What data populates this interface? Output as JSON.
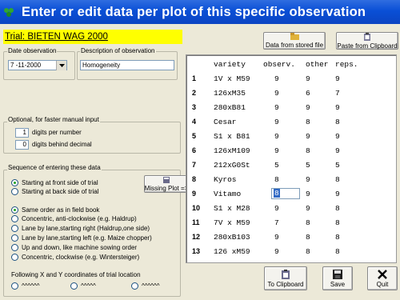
{
  "window": {
    "title": "Enter or edit data per plot of this specific observation",
    "icon": "app-icon"
  },
  "trial": {
    "label": "Trial:  BIETEN WAG 2000"
  },
  "date_observation": {
    "label": "Date observation",
    "value": "7 -11-2000"
  },
  "description": {
    "label": "Description of observation",
    "value": "Homogeneity"
  },
  "optional": {
    "label": "Optional, for faster manual input",
    "digits_per_number_value": "1",
    "digits_per_number_label": "digits per number",
    "digits_decimal_value": "0",
    "digits_decimal_label": "digits behind decimal"
  },
  "sequence": {
    "label": "Sequence of entering these data",
    "side_options": [
      {
        "label": "Starting at front side of trial",
        "checked": true
      },
      {
        "label": "Starting at back side of trial",
        "checked": false
      }
    ],
    "order_options": [
      {
        "label": "Same order as in field book",
        "checked": true
      },
      {
        "label": "Concentric, anti-clockwise (e.g. Haldrup)",
        "checked": false
      },
      {
        "label": "Lane by lane,starting right (Haldrup,one side)",
        "checked": false
      },
      {
        "label": "Lane by lane,starting left (e.g. Maize chopper)",
        "checked": false
      },
      {
        "label": "Up and down, like machine sowing order",
        "checked": false
      },
      {
        "label": "Concentric, clockwise (e.g. Wintersteiger)",
        "checked": false
      }
    ],
    "coords_label": "Following X and Y coordinates of trial location",
    "coord_options": [
      {
        "label": "^^^^^^",
        "checked": false
      },
      {
        "label": "^^^^^",
        "checked": false
      },
      {
        "label": "^^^^^^",
        "checked": false
      }
    ]
  },
  "buttons": {
    "data_from_file": "Data from stored file",
    "paste_clipboard": "Paste from Clipboard",
    "missing_plot": "Missing Plot =>",
    "to_clipboard": "To Clipboard",
    "save": "Save",
    "quit": "Quit"
  },
  "grid": {
    "headers": [
      "variety",
      "observ.",
      "other",
      "reps."
    ],
    "rows": [
      {
        "n": "1",
        "variety": "1V x M59",
        "obs": "9",
        "o1": "9",
        "o2": "9"
      },
      {
        "n": "2",
        "variety": "126xM35",
        "obs": "9",
        "o1": "6",
        "o2": "7"
      },
      {
        "n": "3",
        "variety": "280xB81",
        "obs": "9",
        "o1": "9",
        "o2": "9"
      },
      {
        "n": "4",
        "variety": "Cesar",
        "obs": "9",
        "o1": "8",
        "o2": "8"
      },
      {
        "n": "5",
        "variety": "S1 x B81",
        "obs": "9",
        "o1": "9",
        "o2": "9"
      },
      {
        "n": "6",
        "variety": "126xM109",
        "obs": "9",
        "o1": "8",
        "o2": "9"
      },
      {
        "n": "7",
        "variety": "212xG0St",
        "obs": "5",
        "o1": "5",
        "o2": "5"
      },
      {
        "n": "8",
        "variety": "Kyros",
        "obs": "8",
        "o1": "9",
        "o2": "8"
      },
      {
        "n": "9",
        "variety": "Vitamo",
        "obs": "8",
        "o1": "9",
        "o2": "9"
      },
      {
        "n": "10",
        "variety": "S1 x M28",
        "obs": "9",
        "o1": "9",
        "o2": "8"
      },
      {
        "n": "11",
        "variety": "7V x M59",
        "obs": "7",
        "o1": "8",
        "o2": "8"
      },
      {
        "n": "12",
        "variety": "280xB103",
        "obs": "9",
        "o1": "8",
        "o2": "8"
      },
      {
        "n": "13",
        "variety": "126 xM59",
        "obs": "9",
        "o1": "8",
        "o2": "8"
      }
    ]
  }
}
